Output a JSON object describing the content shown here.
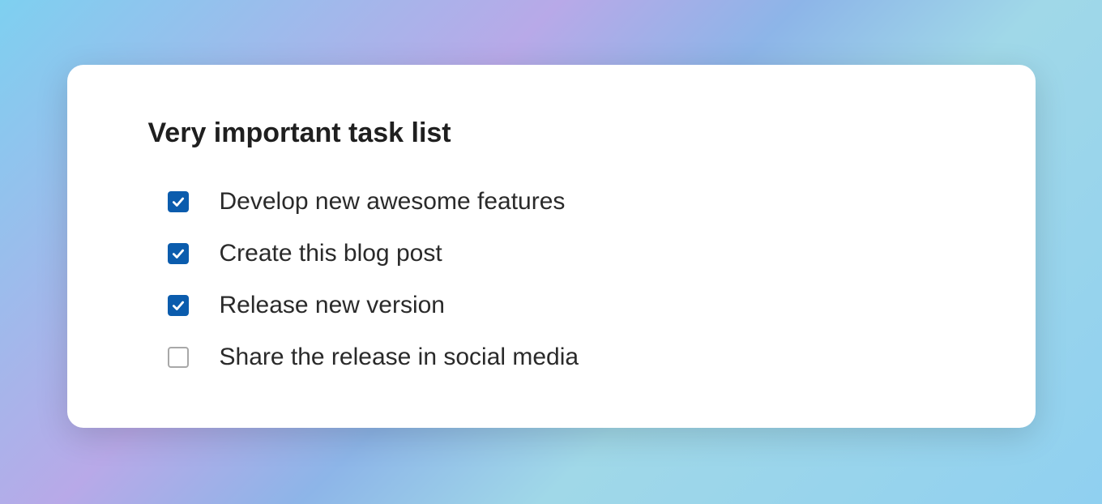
{
  "title": "Very important task list",
  "tasks": [
    {
      "label": "Develop new awesome features",
      "checked": true
    },
    {
      "label": "Create this blog post",
      "checked": true
    },
    {
      "label": "Release new version",
      "checked": true
    },
    {
      "label": "Share the release in social media",
      "checked": false
    }
  ]
}
